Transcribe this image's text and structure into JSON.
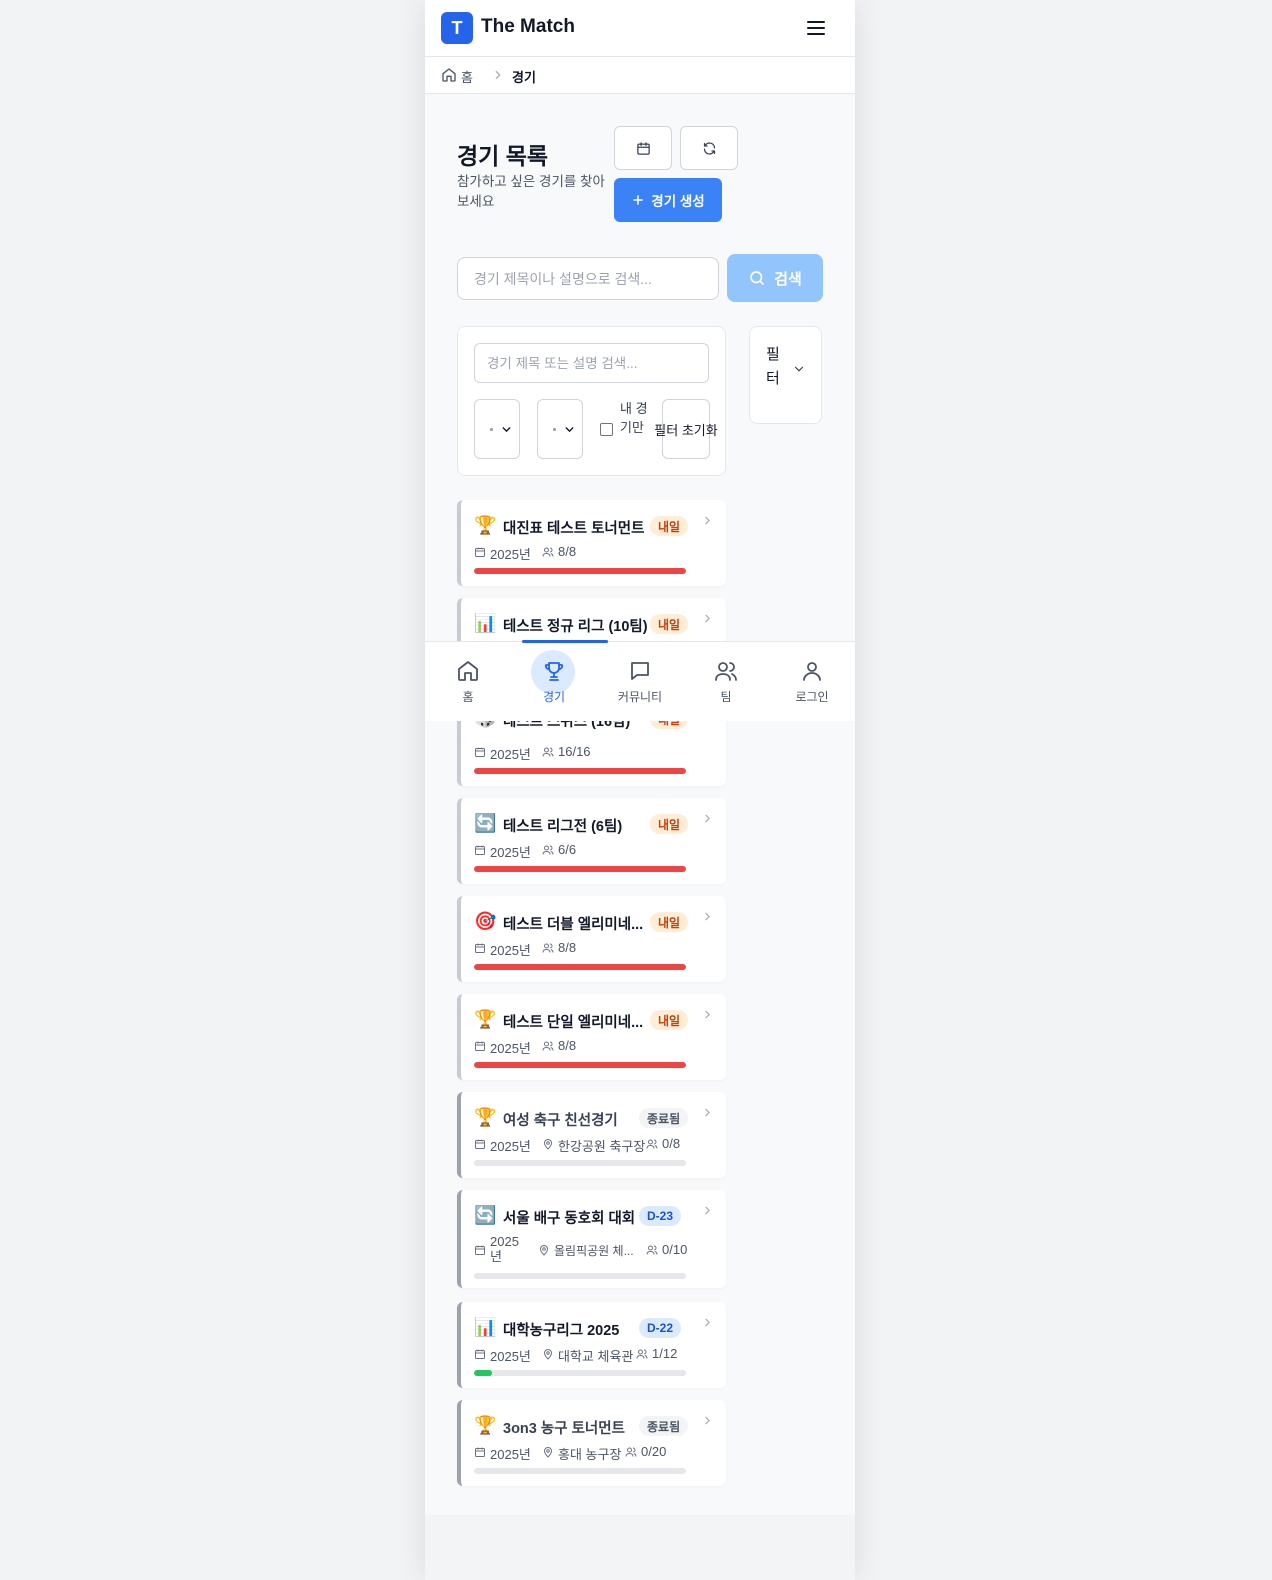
{
  "header": {
    "logo_letter": "T",
    "app_name": "The Match"
  },
  "breadcrumb": {
    "home": "홈",
    "current": "경기"
  },
  "page": {
    "title": "경기 목록",
    "subtitle": "참가하고 싶은 경기를 찾아보세요",
    "create_label": "경기 생성"
  },
  "search": {
    "placeholder": "경기 제목이나 설명으로 검색...",
    "button_label": "검색"
  },
  "filters": {
    "placeholder": "경기 제목 또는 설명 검색...",
    "my_only_label": "내 경기만",
    "reset_label": "필터 초기화",
    "toggle_label": "필터"
  },
  "matches": [
    {
      "emoji": "🏆",
      "title": "대진표 테스트 토너먼트",
      "badge": "내일",
      "date": "2025년",
      "count": "8/8"
    },
    {
      "emoji": "📊",
      "title": "테스트 정규 리그 (10팀)",
      "badge": "내일"
    },
    {
      "emoji": "🎲",
      "title": "테스트 스위스 (16팀)",
      "badge": "내일",
      "date": "2025년",
      "count": "16/16"
    },
    {
      "emoji": "🔄",
      "title": "테스트 리그전 (6팀)",
      "badge": "내일",
      "date": "2025년",
      "count": "6/6"
    },
    {
      "emoji": "🎯",
      "title": "테스트 더블 엘리미네...",
      "badge": "내일",
      "date": "2025년",
      "count": "8/8"
    },
    {
      "emoji": "🏆",
      "title": "테스트 단일 엘리미네...",
      "badge": "내일",
      "date": "2025년",
      "count": "8/8"
    },
    {
      "emoji": "🏆",
      "title": "여성 축구 친선경기",
      "badge": "종료됨",
      "date": "2025년",
      "location": "한강공원 축구장",
      "count": "0/8"
    },
    {
      "emoji": "🔄",
      "title": "서울 배구 동호회 대회",
      "badge": "D-23",
      "date": "2025년",
      "location": "올림픽공원 체...",
      "count": "0/10"
    },
    {
      "emoji": "📊",
      "title": "대학농구리그 2025",
      "badge": "D-22",
      "date": "2025년",
      "location": "대학교 체육관",
      "count": "1/12"
    },
    {
      "emoji": "🏆",
      "title": "3on3 농구 토너먼트",
      "badge": "종료됨",
      "date": "2025년",
      "location": "홍대 농구장",
      "count": "0/20"
    }
  ],
  "progress": {
    "full_color": "#ef4444",
    "partial_color": "#22c55e",
    "fractions": [
      1,
      1,
      1,
      1,
      1,
      1,
      0,
      0,
      0.083,
      0
    ]
  },
  "bottom_nav": [
    {
      "label": "홈",
      "icon": "home-icon"
    },
    {
      "label": "경기",
      "icon": "trophy-icon",
      "active": true
    },
    {
      "label": "커뮤니티",
      "icon": "chat-icon"
    },
    {
      "label": "팀",
      "icon": "users-icon"
    },
    {
      "label": "로그인",
      "icon": "user-icon"
    }
  ],
  "colors": {
    "primary": "#2563eb",
    "primary_light": "#3b82f6",
    "search_disabled": "#93c5fd",
    "tomorrow_bg": "#ffedd5",
    "tomorrow_text": "#c2410c"
  }
}
